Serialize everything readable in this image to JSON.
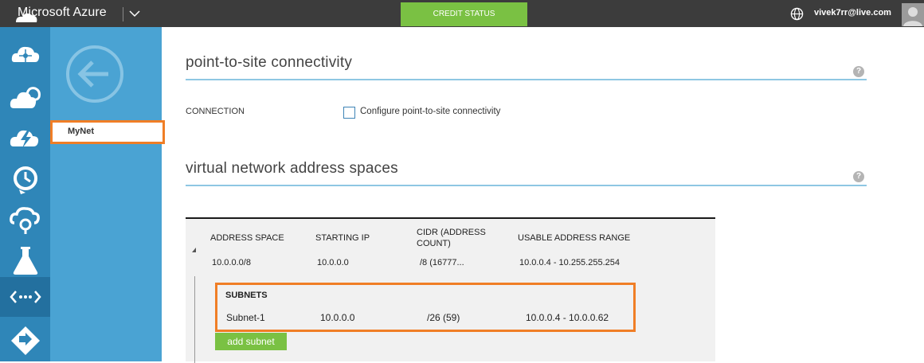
{
  "topbar": {
    "brand": "Microsoft Azure",
    "credit_status": "CREDIT STATUS",
    "user_email": "vivek7rr@live.com"
  },
  "nav": {
    "selected_item": "MyNet"
  },
  "p2s": {
    "title": "point-to-site connectivity",
    "connection_label": "CONNECTION",
    "checkbox_label": "Configure point-to-site connectivity",
    "checked": false
  },
  "vnet": {
    "title": "virtual network address spaces",
    "columns": [
      "ADDRESS SPACE",
      "STARTING IP",
      "CIDR (ADDRESS COUNT)",
      "USABLE ADDRESS RANGE"
    ],
    "rows": [
      {
        "address_space": "10.0.0.0/8",
        "starting_ip": "10.0.0.0",
        "cidr": "/8 (16777...",
        "range": "10.0.0.4 - 10.255.255.254"
      }
    ],
    "subnets_header": "SUBNETS",
    "subnets": [
      {
        "name": "Subnet-1",
        "starting_ip": "10.0.0.0",
        "cidr": "/26 (59)",
        "range": "10.0.0.4 - 10.0.0.62"
      }
    ],
    "add_subnet_label": "add subnet"
  },
  "colors": {
    "topbar": "#3c3c3c",
    "iconbar": "#2f86b8",
    "navpanel": "#4aa3d3",
    "accent_green": "#7ac143",
    "highlight_orange": "#f07e26"
  },
  "help_glyph": "?"
}
